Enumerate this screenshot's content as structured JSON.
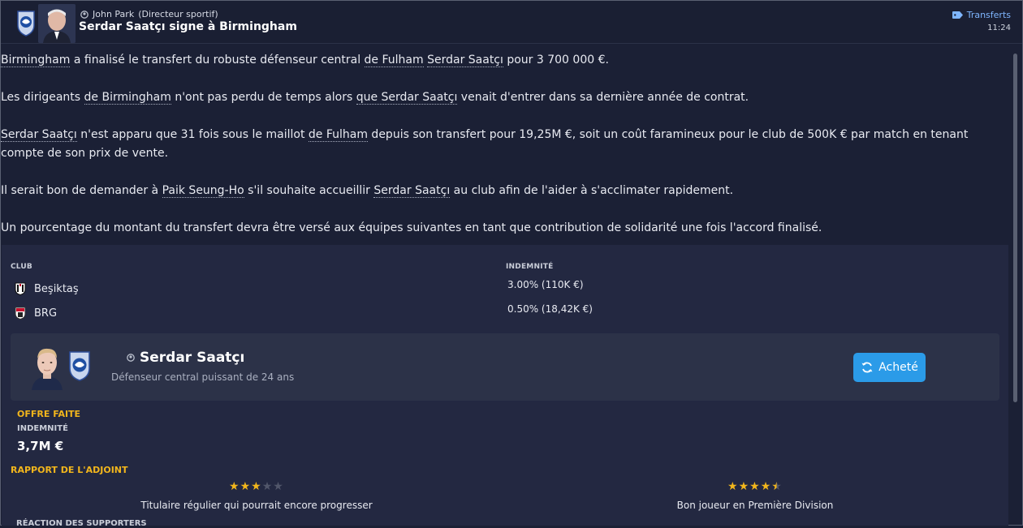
{
  "header": {
    "sender_name": "John Park",
    "sender_role": "(Directeur sportif)",
    "headline": "Serdar Saatçı signe à Birmingham",
    "category": "Transferts",
    "time": "11:24",
    "category_icon": "tag-icon"
  },
  "article": {
    "p1": {
      "a": "Birmingham",
      "b": " a finalisé le transfert du robuste défenseur central ",
      "c": "de Fulham",
      "d": " ",
      "e": "Serdar Saatçı",
      "f": " pour 3 700 000 €."
    },
    "p2": {
      "a": "Les dirigeants ",
      "b": "de Birmingham",
      "c": " n'ont pas perdu de temps alors ",
      "d": "que Serdar Saatçı",
      "e": " venait d'entrer dans sa dernière année de contrat."
    },
    "p3": {
      "a": "Serdar Saatçı",
      "b": " n'est apparu que 31 fois sous le maillot ",
      "c": "de Fulham",
      "d": " depuis son transfert pour 19,25M €, soit un coût faramineux pour le club de 500K € par match en tenant compte de son prix de vente."
    },
    "p4": {
      "a": "Il serait bon de demander à ",
      "b": "Paik Seung-Ho",
      "c": " s'il souhaite accueillir ",
      "d": "Serdar Saatçı",
      "e": " au club afin de l'aider à s'acclimater rapidement."
    },
    "p5": "Un pourcentage du montant du transfert devra être versé aux équipes suivantes en tant que contribution de solidarité une fois l'accord finalisé."
  },
  "solidarity": {
    "col_club": "CLUB",
    "col_indem": "INDEMNITÉ",
    "rows": [
      {
        "club": "Beşiktaş",
        "amount": "3.00% (110K €)"
      },
      {
        "club": "BRG",
        "amount": "0.50% (18,42K €)"
      }
    ]
  },
  "player": {
    "name": "Serdar Saatçı",
    "description": "Défenseur central puissant de 24 ans",
    "status_label": "Acheté"
  },
  "offer": {
    "title": "OFFRE FAITE",
    "fee_label": "INDEMNITÉ",
    "fee_value": "3,7M €"
  },
  "report": {
    "title": "RAPPORT DE L'ADJOINT",
    "current": {
      "stars": 3,
      "max": 5,
      "text": "Titulaire régulier qui pourrait encore progresser"
    },
    "potential": {
      "stars": 4.5,
      "max": 5,
      "text": "Bon joueur en Première Division"
    },
    "next_section": "RÉACTION DES SUPPORTERS"
  },
  "colors": {
    "background": "#1b2035",
    "accent_gold": "#f2b61c",
    "button_blue": "#2b9be8",
    "link_blue": "#7fb6ff"
  }
}
